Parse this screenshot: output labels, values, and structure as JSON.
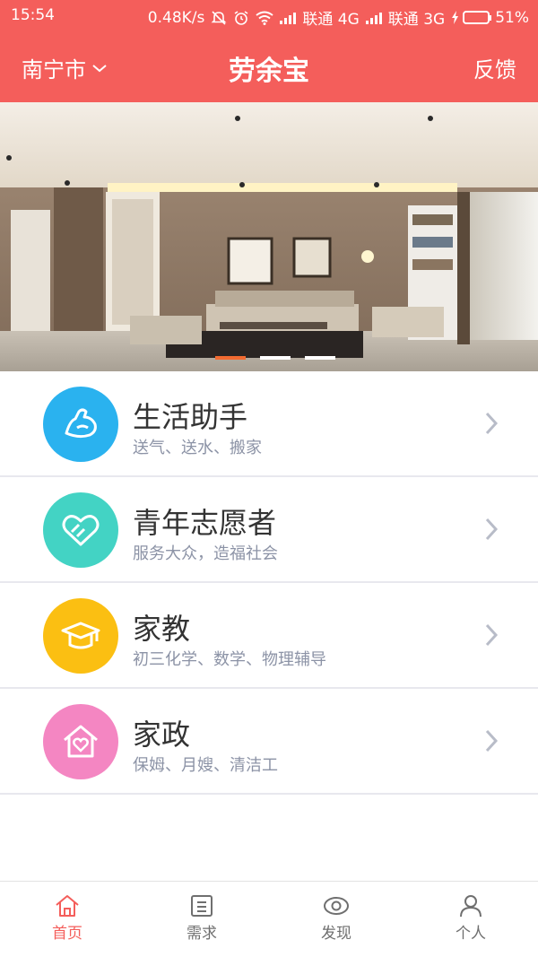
{
  "status_bar": {
    "time": "15:54",
    "speed": "0.48K/s",
    "carrier1": "联通 4G",
    "carrier2": "联通 3G",
    "battery": "51%",
    "battery_level": 0.51
  },
  "header": {
    "city": "南宁市",
    "title": "劳余宝",
    "feedback": "反馈",
    "bg_color": "#f45e5b"
  },
  "banner": {
    "slide_count": 3,
    "active_slide": 1,
    "indicator_active_color": "#f26b31"
  },
  "list": [
    {
      "title": "生活助手",
      "subtitle": "送气、送水、搬家",
      "icon": "arm-muscle-icon",
      "color": "#2ab2ef"
    },
    {
      "title": "青年志愿者",
      "subtitle": "服务大众，造福社会",
      "icon": "heart-hands-icon",
      "color": "#43d3c4"
    },
    {
      "title": "家教",
      "subtitle": "初三化学、数学、物理辅导",
      "icon": "graduation-cap-icon",
      "color": "#fbbf12"
    },
    {
      "title": "家政",
      "subtitle": "保姆、月嫂、清洁工",
      "icon": "house-heart-icon",
      "color": "#f486c2"
    }
  ],
  "tabs": [
    {
      "label": "首页",
      "icon": "home-icon",
      "active": true
    },
    {
      "label": "需求",
      "icon": "list-icon",
      "active": false
    },
    {
      "label": "发现",
      "icon": "eye-icon",
      "active": false
    },
    {
      "label": "个人",
      "icon": "person-icon",
      "active": false
    }
  ]
}
